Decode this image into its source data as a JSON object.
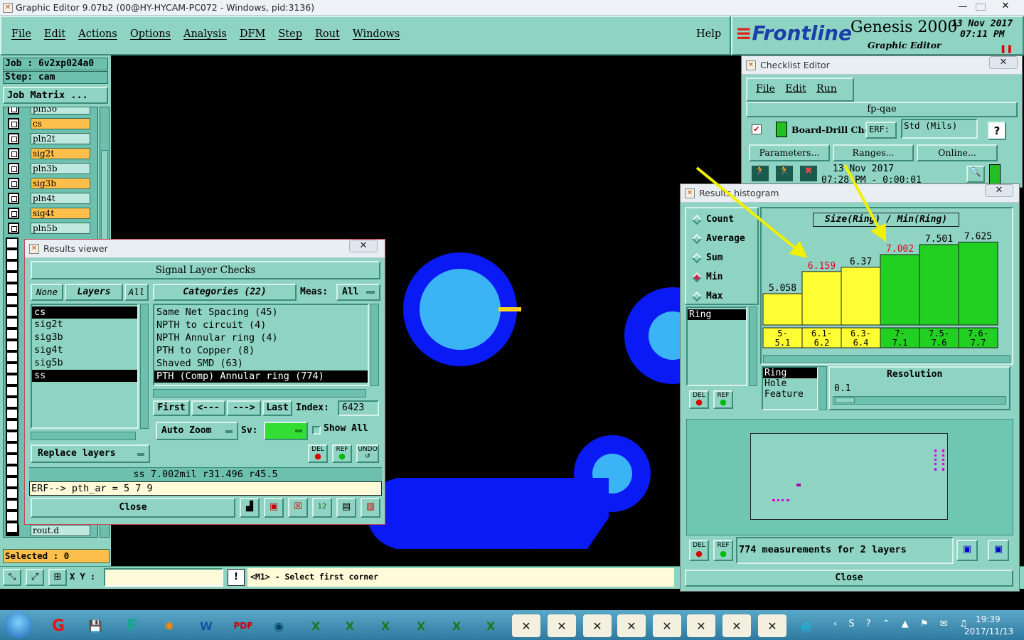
{
  "titlebar": {
    "title": "Graphic Editor 9.07b2 (00@HY-HYCAM-PC072 - Windows, pid:3136)"
  },
  "menu": {
    "items": [
      "File",
      "Edit",
      "Actions",
      "Options",
      "Analysis",
      "DFM",
      "Step",
      "Rout",
      "Windows"
    ],
    "help": "Help"
  },
  "brand": {
    "logo": "Frontline",
    "product": "Genesis 2000",
    "subtitle": "Graphic Editor",
    "date": "13 Nov 2017",
    "time": "07:11 PM"
  },
  "job": {
    "job_label": "Job : 6v2xp024a0",
    "step_label": "Step: cam",
    "matrix_button": "Job Matrix ..."
  },
  "layers": [
    {
      "name": "cs",
      "color": "orange"
    },
    {
      "name": "pln2t",
      "color": "teal"
    },
    {
      "name": "sig2t",
      "color": "orange"
    },
    {
      "name": "pln3b",
      "color": "teal"
    },
    {
      "name": "sig3b",
      "color": "orange"
    },
    {
      "name": "pln4t",
      "color": "teal"
    },
    {
      "name": "sig4t",
      "color": "orange"
    },
    {
      "name": "pln5b",
      "color": "teal"
    }
  ],
  "layer_bottom": "rout.d",
  "selected_text": "Selected : 0",
  "status": {
    "xy_label": "X Y :",
    "xy_value": "",
    "prompt": "<M1> - Select first corner"
  },
  "results_viewer": {
    "title": "Results viewer",
    "header": "Signal Layer Checks",
    "none_btn": "None",
    "layers_btn": "Layers",
    "all_btn": "All",
    "categories_btn": "Categories (22)",
    "meas_label": "Meas:",
    "meas_value": "All",
    "layers": [
      "cs",
      "sig2t",
      "sig3b",
      "sig4t",
      "sig5b",
      "ss"
    ],
    "categories": [
      "Same Net Spacing (45)",
      "NPTH to circuit (4)",
      "NPTH Annular ring (4)",
      "PTH to Copper (8)",
      "Shaved SMD (63)",
      "PTH (Comp) Annular ring (774)"
    ],
    "nav": {
      "first": "First",
      "prev": "<---",
      "next": "--->",
      "last": "Last",
      "index_label": "Index:",
      "index_value": "6423"
    },
    "auto_zoom": "Auto Zoom",
    "sv_label": "Sv:",
    "show_all": "Show All",
    "replace_layers": "Replace layers",
    "del": "DEL",
    "ref": "REF",
    "undo": "UNDO",
    "info_line": "ss 7.002mil  r31.496  r45.5",
    "erf_line": "ERF--> pth_ar = 5 7 9",
    "close": "Close"
  },
  "checklist_editor": {
    "title": "Checklist Editor",
    "menu": [
      "File",
      "Edit",
      "Run"
    ],
    "name": "fp-qae",
    "action": "Board-Drill Che",
    "erf_label": "ERF:",
    "erf_value": "Std (Mils)",
    "help": "?",
    "buttons": [
      "Parameters...",
      "Ranges...",
      "Online..."
    ],
    "run_date": "13 Nov 2017",
    "run_time": "07:28 PM - 0:00:01"
  },
  "histogram": {
    "title": "Results histogram",
    "modes": [
      {
        "label": "Count",
        "on": false
      },
      {
        "label": "Average",
        "on": false
      },
      {
        "label": "Sum",
        "on": false
      },
      {
        "label": "Min",
        "on": true
      },
      {
        "label": "Max",
        "on": false
      }
    ],
    "list_selected": "Ring",
    "chart_title": "Size(Ring) / Min(Ring)",
    "bins": [
      {
        "label": "5-5.1",
        "value": 5.058,
        "color": "#ffff33",
        "value_color": "#000000"
      },
      {
        "label": "6.1-6.2",
        "value": 6.159,
        "color": "#ffff33",
        "value_color": "#e8001c"
      },
      {
        "label": "6.3-6.4",
        "value": 6.37,
        "color": "#ffff33",
        "value_color": "#000000"
      },
      {
        "label": "7-7.1",
        "value": 7.002,
        "color": "#22d022",
        "value_color": "#e8001c"
      },
      {
        "label": "7.5-7.6",
        "value": 7.501,
        "color": "#22d022",
        "value_color": "#000000"
      },
      {
        "label": "7.6-7.7",
        "value": 7.625,
        "color": "#22d022",
        "value_color": "#000000"
      }
    ],
    "value_range": [
      3.5,
      8.1
    ],
    "attr_list": [
      "Ring",
      "Hole",
      "Feature"
    ],
    "resolution_label": "Resolution",
    "resolution_value": "0.1",
    "summary": "774 measurements for 2 layers",
    "close": "Close"
  },
  "taskbar": {
    "time": "19:39",
    "date": "2017/11/13"
  }
}
